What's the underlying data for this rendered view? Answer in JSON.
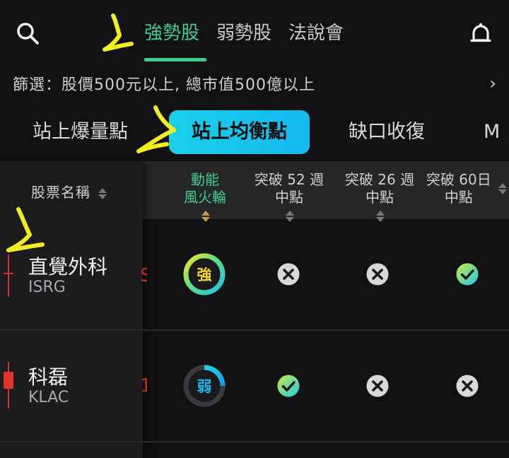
{
  "header": {
    "tabs": [
      {
        "label": "強勢股",
        "active": true
      },
      {
        "label": "弱勢股",
        "active": false
      },
      {
        "label": "法說會",
        "active": false
      }
    ],
    "search_icon": "search-icon",
    "bell_icon": "bell-icon"
  },
  "filter": {
    "text": "篩選：股價500元以上, 總市值500億以上",
    "chevron": "›"
  },
  "chips": [
    {
      "label": "站上爆量點",
      "active": false
    },
    {
      "label": "站上均衡點",
      "active": true
    },
    {
      "label": "缺口收復",
      "active": false
    },
    {
      "label": "M",
      "active": false
    }
  ],
  "table": {
    "columns": {
      "name": "股票名稱",
      "momentum": [
        "動能",
        "風火輪"
      ],
      "break52": [
        "突破 52 週",
        "中點"
      ],
      "break26": [
        "突破 26 週",
        "中點"
      ],
      "break60": [
        "突破 60日",
        "中點"
      ]
    },
    "rows": [
      {
        "name": "直覺外科",
        "code": "ISRG",
        "momentum": "強",
        "break52": "fail",
        "break26": "fail",
        "break60": "pass"
      },
      {
        "name": "科磊",
        "code": "KLAC",
        "momentum": "弱",
        "break52": "pass",
        "break26": "fail",
        "break60": "fail"
      }
    ]
  },
  "colors": {
    "accent_green": "#3ccf8e",
    "chip_cyan": "#19d0e7",
    "candle_red": "#e0342c",
    "annotation_yellow": "#f4ef1c"
  }
}
